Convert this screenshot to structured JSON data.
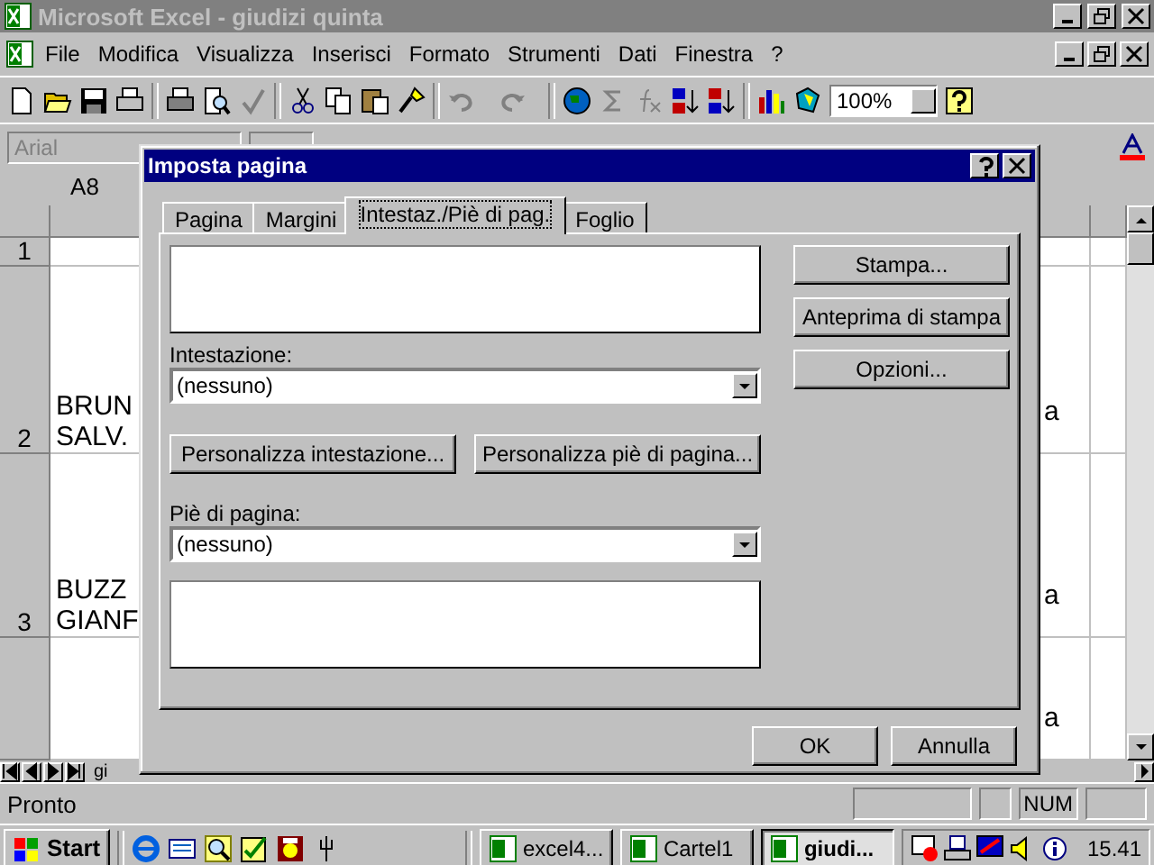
{
  "window": {
    "title": "Microsoft Excel - giudizi quinta"
  },
  "menu": [
    "File",
    "Modifica",
    "Visualizza",
    "Inserisci",
    "Formato",
    "Strumenti",
    "Dati",
    "Finestra",
    "?"
  ],
  "toolbar": {
    "zoom": "100%"
  },
  "format_toolbar": {
    "font": {
      "value": "Arial",
      "disabled": true
    }
  },
  "name_box": "A8",
  "grid": {
    "rows": [
      {
        "header": "1"
      },
      {
        "header": "2",
        "cell_a": [
          "BRUN",
          "SALV."
        ],
        "cell_c": "a"
      },
      {
        "header": "3",
        "cell_a": [
          "BUZZ",
          "GIANF"
        ],
        "cell_c": "a"
      },
      {
        "cell_c": "a"
      }
    ]
  },
  "sheet_tab": "gi",
  "status_bar": {
    "text": "Pronto",
    "indicator": "NUM"
  },
  "dialog": {
    "title": "Imposta pagina",
    "tabs": [
      {
        "label": "Pagina",
        "selected": false
      },
      {
        "label": "Margini",
        "selected": false
      },
      {
        "label": "Intestaz./Piè di pag.",
        "selected": true
      },
      {
        "label": "Foglio",
        "selected": false
      }
    ],
    "header_label": "Intestazione:",
    "header_value": "(nessuno)",
    "custom_buttons": [
      "Personalizza intestazione...",
      "Personalizza piè di pagina..."
    ],
    "footer_label": "Piè di pagina:",
    "footer_value": "(nessuno)",
    "side_buttons": [
      "Stampa...",
      "Anteprima di stampa",
      "Opzioni..."
    ],
    "bottom_buttons": [
      "OK",
      "Annulla"
    ]
  },
  "taskbar": {
    "start": "Start",
    "tasks": [
      {
        "label": "excel4...",
        "selected": false
      },
      {
        "label": "Cartel1",
        "selected": false
      },
      {
        "label": "giudi...",
        "selected": true
      }
    ],
    "clock": "15.41"
  }
}
